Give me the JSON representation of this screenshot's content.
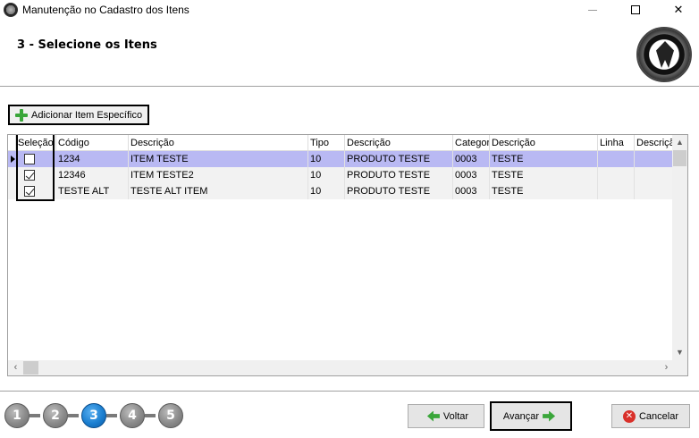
{
  "window": {
    "title": "Manutenção no Cadastro dos Itens",
    "close_glyph": "✕"
  },
  "header": {
    "step_title": "3 - Selecione os Itens"
  },
  "toolbar": {
    "add_item_label": "Adicionar Item Específico"
  },
  "grid": {
    "columns": [
      "Seleção",
      "Código",
      "Descrição",
      "Tipo",
      "Descrição",
      "Categor",
      "Descrição",
      "Linha",
      "Descriçã"
    ],
    "rows": [
      {
        "selected": false,
        "current": true,
        "codigo": "1234",
        "descricao": "ITEM TESTE",
        "tipo": "10",
        "desc_tipo": "PRODUTO TESTE",
        "categoria": "0003",
        "desc_categoria": "TESTE",
        "linha": "",
        "desc_linha": ""
      },
      {
        "selected": true,
        "current": false,
        "codigo": "12346",
        "descricao": "ITEM TESTE2",
        "tipo": "10",
        "desc_tipo": "PRODUTO TESTE",
        "categoria": "0003",
        "desc_categoria": "TESTE",
        "linha": "",
        "desc_linha": ""
      },
      {
        "selected": true,
        "current": false,
        "codigo": "TESTE ALT",
        "descricao": "TESTE ALT ITEM",
        "tipo": "10",
        "desc_tipo": "PRODUTO TESTE",
        "categoria": "0003",
        "desc_categoria": "TESTE",
        "linha": "",
        "desc_linha": ""
      }
    ]
  },
  "wizard": {
    "steps": [
      "1",
      "2",
      "3",
      "4",
      "5"
    ],
    "current_step": "3"
  },
  "buttons": {
    "voltar": "Voltar",
    "avancar": "Avançar",
    "cancelar": "Cancelar"
  },
  "icons": {
    "add": "plus-icon",
    "back": "arrow-left-icon",
    "next": "arrow-right-icon",
    "cancel": "cancel-icon"
  },
  "colors": {
    "selected_row": "#b9b9f3",
    "active_step": "#1b7fd1",
    "accent_green": "#3aa63a",
    "cancel_red": "#d9302a"
  }
}
